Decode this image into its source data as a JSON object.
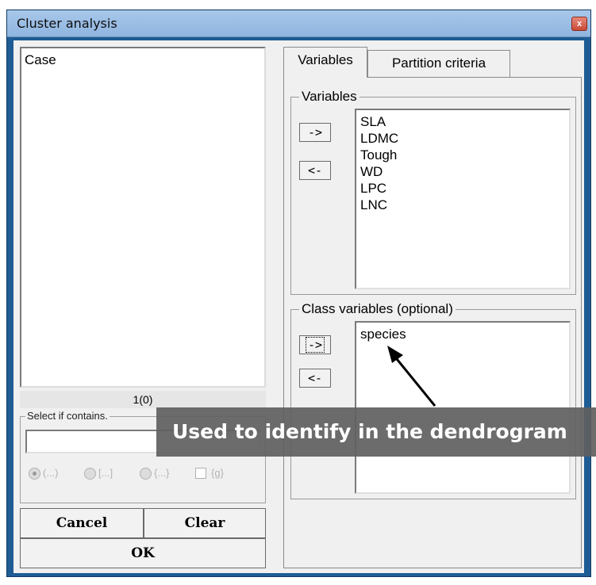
{
  "window": {
    "title": "Cluster analysis",
    "close_glyph": "x"
  },
  "left_panel": {
    "case_list_label": "Case",
    "case_count": "1(0)",
    "select_group_label": "Select if contains.",
    "select_input_value": "",
    "radio_options": [
      "(...)",
      "[...]",
      "{...}"
    ],
    "checkbox_label": "{g}",
    "cancel_label": "Cancel",
    "clear_label": "Clear",
    "ok_label": "OK"
  },
  "tabs": [
    {
      "label": "Variables",
      "active": true
    },
    {
      "label": "Partition criteria",
      "active": false
    }
  ],
  "variables_group": {
    "label": "Variables",
    "add_label": "->",
    "remove_label": "<-",
    "items": [
      "SLA",
      "LDMC",
      "Tough",
      "WD",
      "LPC",
      "LNC"
    ]
  },
  "class_group": {
    "label": "Class variables (optional)",
    "add_label": "->",
    "remove_label": "<-",
    "items": [
      "species"
    ]
  },
  "annotation": {
    "text": "Used to identify in the dendrogram"
  },
  "colors": {
    "frame": "#1f5c94",
    "titlebar": "#a8c7ea",
    "dialog_bg": "#f0f0f0",
    "annotation_bg": "#5f5f5f"
  },
  "icons": [
    "close-icon",
    "annotation-arrow-icon"
  ]
}
